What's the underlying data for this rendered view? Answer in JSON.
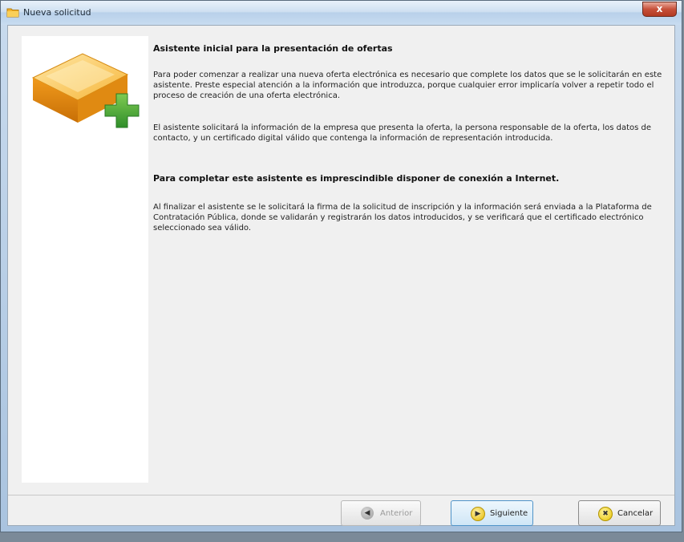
{
  "window": {
    "title": "Nueva solicitud",
    "close_label": "x"
  },
  "wizard": {
    "heading": "Asistente inicial para la presentación de ofertas",
    "paragraphs": [
      "Para poder comenzar a realizar una nueva oferta electrónica es necesario que complete los datos que se le solicitarán en este asistente. Preste especial atención a la información que introduzca, porque cualquier error implicaría volver a repetir todo el proceso de creación de una oferta electrónica.",
      "El asistente solicitará la información de la empresa que presenta la oferta, la persona responsable de la oferta, los datos de contacto, y un certificado digital válido que contenga la información de representación introducida.",
      "Para completar este asistente es imprescindible disponer de conexión a Internet.",
      "Al finalizar el asistente se le solicitará la firma de la solicitud de inscripción y la información será enviada a la Plataforma de Contratación Pública, donde se validarán y registrarán los datos introducidos, y se verificará que el certificado electrónico seleccionado sea válido."
    ]
  },
  "buttons": {
    "previous_label": "Anterior",
    "next_label": "Siguiente",
    "cancel_label": "Cancelar"
  },
  "icons": {
    "window_icon": "folder-icon",
    "wizard_icon": "package-add-icon",
    "previous_icon": "arrow-left-icon",
    "next_icon": "arrow-right-icon",
    "cancel_icon": "cross-icon"
  },
  "colors": {
    "close_button": "#c7503a",
    "next_button_border": "#4f93c8",
    "plus_green": "#3aa03a",
    "box_orange": "#f2a21f"
  }
}
